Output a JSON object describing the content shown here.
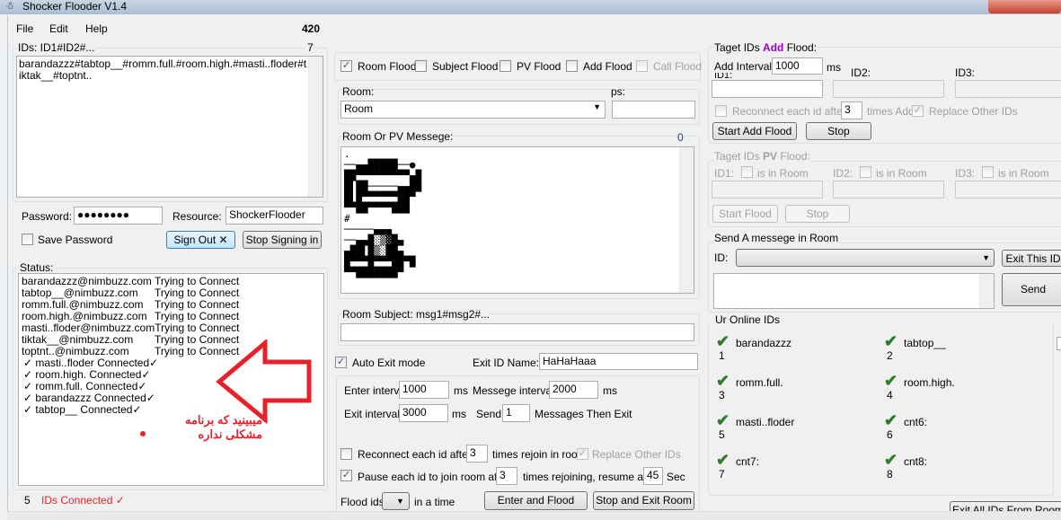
{
  "window": {
    "title": "Shocker Flooder V1.4"
  },
  "menu": {
    "items": [
      "File",
      "Edit",
      "Help"
    ],
    "counter": "420"
  },
  "ids": {
    "label": "IDs: ID1#ID2#...",
    "count": "7",
    "value": "barandazzz#tabtop__#romm.full.#room.high.#masti..floder#tiktak__#toptnt.."
  },
  "login": {
    "password_label": "Password:",
    "password_value": "●●●●●●●●",
    "resource_label": "Resource:",
    "resource_value": "ShockerFlooder",
    "save_password": "Save Password",
    "sign_out": "Sign Out ✕",
    "stop_signing": "Stop Signing in"
  },
  "status": {
    "label": "Status:",
    "lines": [
      [
        "barandazzz@nimbuzz.com",
        "Trying to Connect"
      ],
      [
        "tabtop__@nimbuzz.com",
        "Trying to Connect"
      ],
      [
        "romm.full.@nimbuzz.com",
        "Trying to Connect"
      ],
      [
        "room.high.@nimbuzz.com",
        "Trying to Connect"
      ],
      [
        "masti..floder@nimbuzz.com",
        "Trying to Connect"
      ],
      [
        "tiktak__@nimbuzz.com",
        "Trying to Connect"
      ],
      [
        "toptnt..@nimbuzz.com",
        "Trying to Connect"
      ]
    ],
    "connected": [
      "✓ masti..floder   Connected✓",
      "✓ room.high.   Connected✓",
      "✓ romm.full.   Connected✓",
      "✓ barandazzz   Connected✓",
      "✓ tabtop__   Connected✓"
    ],
    "annotation": "میبینید که برنامه مشکلی نداره",
    "footer_count": "5",
    "footer_text": "IDs Connected ✓"
  },
  "flood_modes": [
    {
      "label": "Room Flood",
      "checked": true
    },
    {
      "label": "Subject Flood",
      "checked": false
    },
    {
      "label": "PV Flood",
      "checked": false
    },
    {
      "label": "Add Flood",
      "checked": false
    },
    {
      "label": "Call Flood",
      "checked": false,
      "disabled": true
    }
  ],
  "room": {
    "label": "Room:",
    "value": "Room",
    "ps_label": "ps:",
    "ps_value": ""
  },
  "message": {
    "label": "Room Or PV Messege:",
    "count": "0"
  },
  "subject": {
    "label": "Room Subject: msg1#msg2#...",
    "value": ""
  },
  "auto_exit": {
    "label": "Auto Exit mode",
    "checked": true,
    "exit_name_label": "Exit ID Name:",
    "exit_name_value": "HaHaHaaa"
  },
  "intervals": {
    "enter_label": "Enter interval",
    "enter_value": "1000",
    "ms": "ms",
    "msg_label": "Messege interval",
    "msg_value": "2000",
    "exit_label": "Exit interval",
    "exit_value": "3000",
    "send_label": "Send",
    "send_value": "1",
    "messages_then_exit": "Messages  Then Exit"
  },
  "reconnect": {
    "label": "Reconnect each id after",
    "value": "3",
    "suffix": "times rejoin in room",
    "replace": "Replace Other IDs"
  },
  "pause": {
    "label": "Pause each id to join room after",
    "value": "3",
    "suffix": "times rejoining, resume after:",
    "resume_value": "45",
    "sec": "Sec"
  },
  "flood_ids": {
    "label": "Flood ids",
    "suffix": "in a time",
    "enter_flood": "Enter and Flood",
    "stop_exit": "Stop and Exit Room"
  },
  "add_flood": {
    "title_pre": "Taget IDs ",
    "title_em": "Add",
    "title_post": " Flood:",
    "interval_label": "Add Interval:",
    "interval_value": "1000",
    "ms": "ms",
    "id1": "ID1:",
    "id2": "ID2:",
    "id3": "ID3:",
    "reconnect": "Reconnect each id after",
    "reconnect_value": "3",
    "times_add": "times Add",
    "replace": "Replace Other IDs",
    "start": "Start Add Flood",
    "stop": "Stop",
    "accent": "#9b00c8"
  },
  "pv_flood": {
    "title_pre": "Taget IDs ",
    "title_em": "PV",
    "title_post": " Flood:",
    "id1": "ID1:",
    "id2": "ID2:",
    "id3": "ID3:",
    "in_room": "is in Room",
    "start": "Start Flood",
    "stop": "Stop"
  },
  "send_room": {
    "title": "Send A messege in Room",
    "id_label": "ID:",
    "exit_id": "Exit This ID",
    "send": "Send"
  },
  "online": {
    "title": "Ur Online IDs",
    "items": [
      {
        "name": "barandazzz",
        "n": "1"
      },
      {
        "name": "tabtop__",
        "n": "2"
      },
      {
        "name": "romm.full.",
        "n": "3"
      },
      {
        "name": "room.high.",
        "n": "4"
      },
      {
        "name": "masti..floder",
        "n": "5"
      },
      {
        "name": "cnt6:",
        "n": "6"
      },
      {
        "name": "cnt7:",
        "n": "7"
      },
      {
        "name": "cnt8:",
        "n": "8"
      }
    ],
    "exit_all": "Exit All IDs From Room"
  }
}
